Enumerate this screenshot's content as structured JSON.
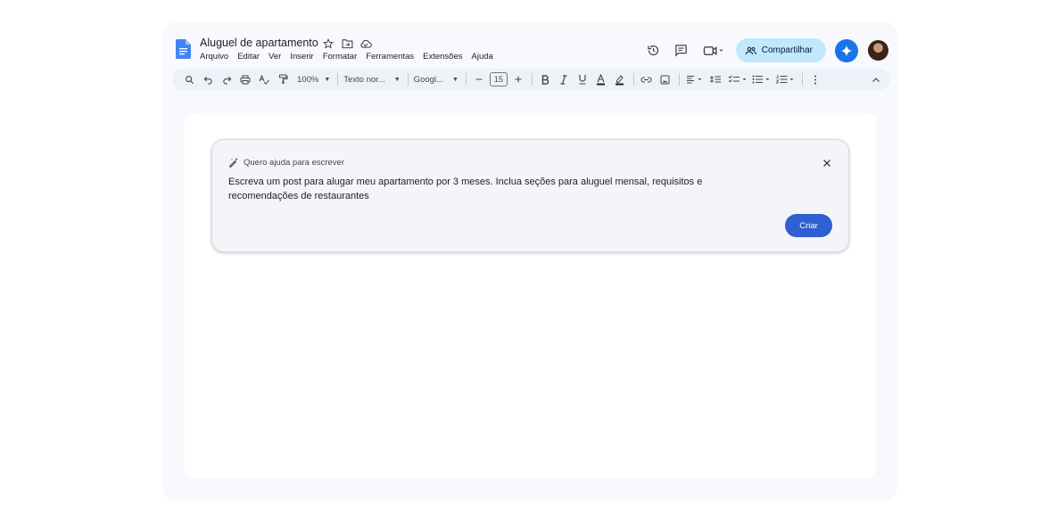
{
  "document": {
    "title": "Aluguel de apartamento"
  },
  "menu": [
    "Arquivo",
    "Editar",
    "Ver",
    "Inserir",
    "Formatar",
    "Ferramentas",
    "Extensões",
    "Ajuda"
  ],
  "header": {
    "share_label": "Compartilhar"
  },
  "toolbar": {
    "zoom": "100%",
    "style": "Texto nor...",
    "font": "Googl...",
    "font_size": "15"
  },
  "assist": {
    "heading": "Quero ajuda para escrever",
    "prompt": "Escreva um post para alugar meu apartamento por 3 meses. Inclua seções para aluguel mensal, requisitos e recomendações de restaurantes",
    "create_label": "Criar"
  },
  "colors": {
    "accent": "#1a73e8",
    "share_bg": "#c2e7ff",
    "create_bg": "#2f5fd0"
  }
}
